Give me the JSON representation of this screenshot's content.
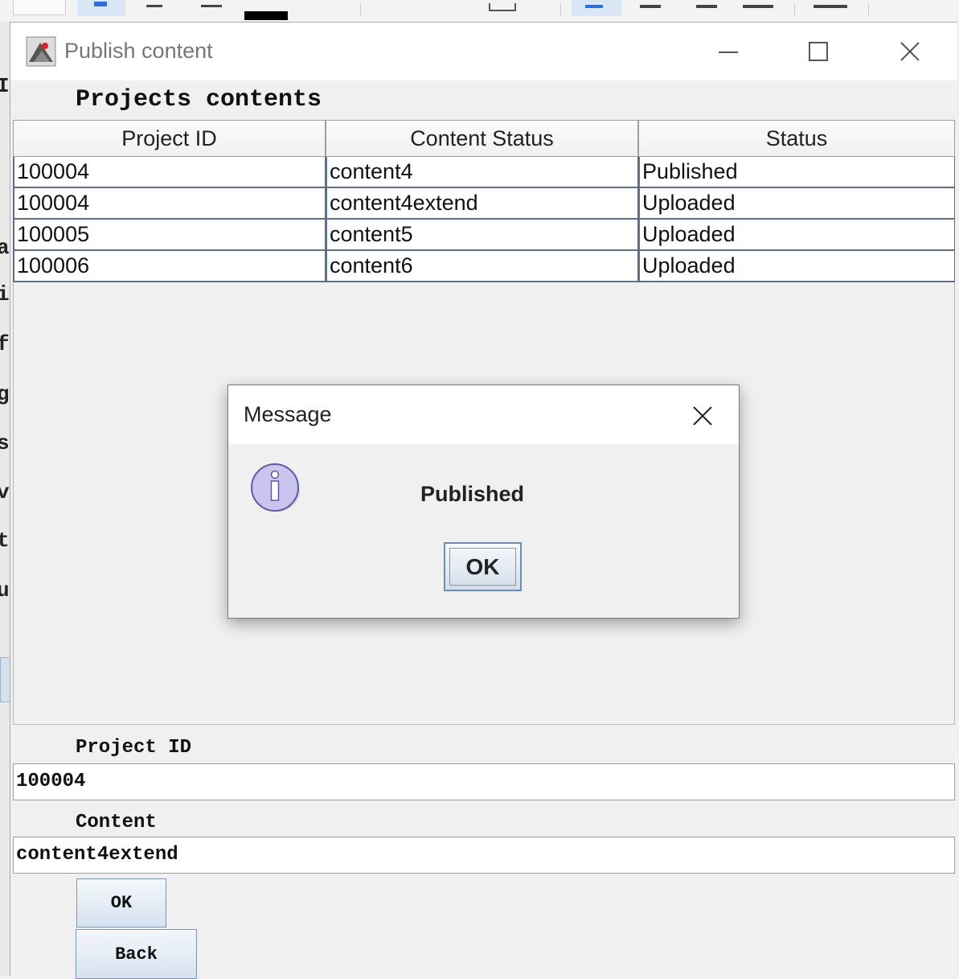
{
  "window": {
    "title": "Publish content",
    "controls": {
      "minimize": "minimize-icon",
      "maximize": "maximize-icon",
      "close": "close-icon"
    }
  },
  "main": {
    "heading": "Projects contents",
    "table": {
      "columns": [
        "Project ID",
        "Content Status",
        "Status"
      ],
      "rows": [
        [
          "100004",
          "content4",
          "Published"
        ],
        [
          "100004",
          "content4extend",
          "Uploaded"
        ],
        [
          "100005",
          "content5",
          "Uploaded"
        ],
        [
          "100006",
          "content6",
          "Uploaded"
        ]
      ]
    },
    "project_id_label": "Project ID",
    "project_id_value": "100004",
    "content_label": "Content",
    "content_value": "content4extend",
    "ok_label": "OK",
    "back_label": "Back"
  },
  "dialog": {
    "title": "Message",
    "message": "Published",
    "ok_label": "OK",
    "icon": "info-icon"
  },
  "background": {
    "side_chars": [
      "a",
      "i",
      "f",
      "g",
      "s",
      "v",
      "t",
      "u"
    ]
  },
  "colors": {
    "row_border": "#5e6f86",
    "button_border": "#7c96b3",
    "info_icon": "#c9c5ee"
  }
}
